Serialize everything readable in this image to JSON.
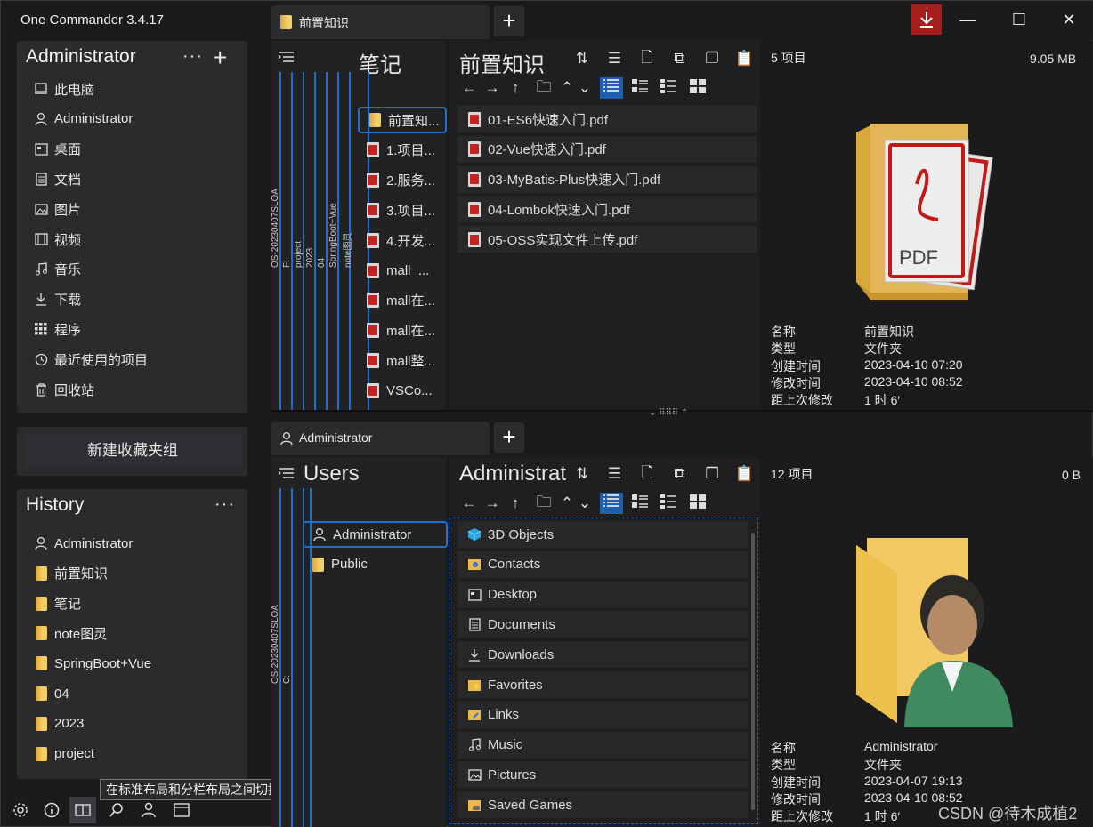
{
  "app": {
    "title": "One Commander 3.4.17"
  },
  "top_tab": {
    "label": "前置知识"
  },
  "bottom_tab": {
    "label": "Administrator"
  },
  "tab_add": "+",
  "win": {
    "minimize": "—",
    "maximize": "☐",
    "close": "✕"
  },
  "favorites": {
    "title": "Administrator",
    "more": "···",
    "add": "+",
    "items": [
      {
        "label": "此电脑",
        "icon": "computer-icon"
      },
      {
        "label": "Administrator",
        "icon": "user-icon"
      },
      {
        "label": "桌面",
        "icon": "desktop-icon"
      },
      {
        "label": "文档",
        "icon": "document-icon"
      },
      {
        "label": "图片",
        "icon": "picture-icon"
      },
      {
        "label": "视频",
        "icon": "video-icon"
      },
      {
        "label": "音乐",
        "icon": "music-icon"
      },
      {
        "label": "下载",
        "icon": "download-icon"
      },
      {
        "label": "程序",
        "icon": "apps-icon"
      },
      {
        "label": "最近使用的项目",
        "icon": "recent-icon"
      },
      {
        "label": "回收站",
        "icon": "trash-icon"
      }
    ]
  },
  "new_group": "新建收藏夹组",
  "history": {
    "title": "History",
    "more": "···",
    "items": [
      {
        "label": "Administrator",
        "icon": "user-icon"
      },
      {
        "label": "前置知识",
        "icon": "folder-icon"
      },
      {
        "label": "笔记",
        "icon": "folder-icon"
      },
      {
        "label": "note图灵",
        "icon": "folder-icon"
      },
      {
        "label": "SpringBoot+Vue",
        "icon": "folder-icon"
      },
      {
        "label": "04",
        "icon": "folder-icon"
      },
      {
        "label": "2023",
        "icon": "folder-icon"
      },
      {
        "label": "project",
        "icon": "folder-icon"
      }
    ]
  },
  "tooltip": "在标准布局和分栏布局之间切换",
  "top_pane": {
    "vertical_crumbs": [
      "OS-20230407SLOA",
      "F:",
      "project",
      "2023",
      "04",
      "SpringBoot+Vue",
      "note图灵"
    ],
    "parent_header": "笔记",
    "parent_items": [
      {
        "label": "前置知...",
        "type": "folder",
        "selected": true
      },
      {
        "label": "1.项目...",
        "type": "pdf"
      },
      {
        "label": "2.服务...",
        "type": "pdf"
      },
      {
        "label": "3.项目...",
        "type": "pdf"
      },
      {
        "label": "4.开发...",
        "type": "pdf"
      },
      {
        "label": "mall_...",
        "type": "pdf"
      },
      {
        "label": "mall在...",
        "type": "pdf"
      },
      {
        "label": "mall在...",
        "type": "pdf"
      },
      {
        "label": "mall整...",
        "type": "pdf"
      },
      {
        "label": "VSCo...",
        "type": "pdf"
      }
    ],
    "current_header": "前置知识",
    "files": [
      "01-ES6快速入门.pdf",
      "02-Vue快速入门.pdf",
      "03-MyBatis-Plus快速入门.pdf",
      "04-Lombok快速入门.pdf",
      "05-OSS实现文件上传.pdf"
    ],
    "count": "5 项目",
    "size": "9.05 MB",
    "info": [
      {
        "label": "名称",
        "value": "前置知识"
      },
      {
        "label": "类型",
        "value": "文件夹"
      },
      {
        "label": "创建时间",
        "value": "2023-04-10  07:20"
      },
      {
        "label": "修改时间",
        "value": "2023-04-10  08:52"
      },
      {
        "label": "距上次修改",
        "value": "1 时 6′"
      }
    ]
  },
  "bottom_pane": {
    "vertical_crumbs": [
      "OS-20230407SLOA",
      "C:"
    ],
    "parent_header": "Users",
    "parent_items": [
      {
        "label": "Administrator",
        "type": "user",
        "selected": true
      },
      {
        "label": "Public",
        "type": "folder"
      }
    ],
    "current_header": "Administrat",
    "files": [
      {
        "label": "3D Objects",
        "icon": "cube-icon"
      },
      {
        "label": "Contacts",
        "icon": "contacts-icon"
      },
      {
        "label": "Desktop",
        "icon": "desktop-icon"
      },
      {
        "label": "Documents",
        "icon": "document-icon"
      },
      {
        "label": "Downloads",
        "icon": "download-icon"
      },
      {
        "label": "Favorites",
        "icon": "star-folder-icon"
      },
      {
        "label": "Links",
        "icon": "links-icon"
      },
      {
        "label": "Music",
        "icon": "music-icon"
      },
      {
        "label": "Pictures",
        "icon": "picture-icon"
      },
      {
        "label": "Saved Games",
        "icon": "games-icon"
      }
    ],
    "count": "12 项目",
    "size": "0 B",
    "info": [
      {
        "label": "名称",
        "value": "Administrator"
      },
      {
        "label": "类型",
        "value": "文件夹"
      },
      {
        "label": "创建时间",
        "value": "2023-04-07  19:13"
      },
      {
        "label": "修改时间",
        "value": "2023-04-10  08:52"
      },
      {
        "label": "距上次修改",
        "value": "1 时 6′"
      }
    ]
  },
  "preview_pdf_text": "PDF",
  "watermark": "CSDN @待木成植2",
  "colors": {
    "accent": "#1e6fd0",
    "download": "#a51d1d",
    "panel": "#2b2b2e",
    "bg": "#1b1b1d"
  }
}
